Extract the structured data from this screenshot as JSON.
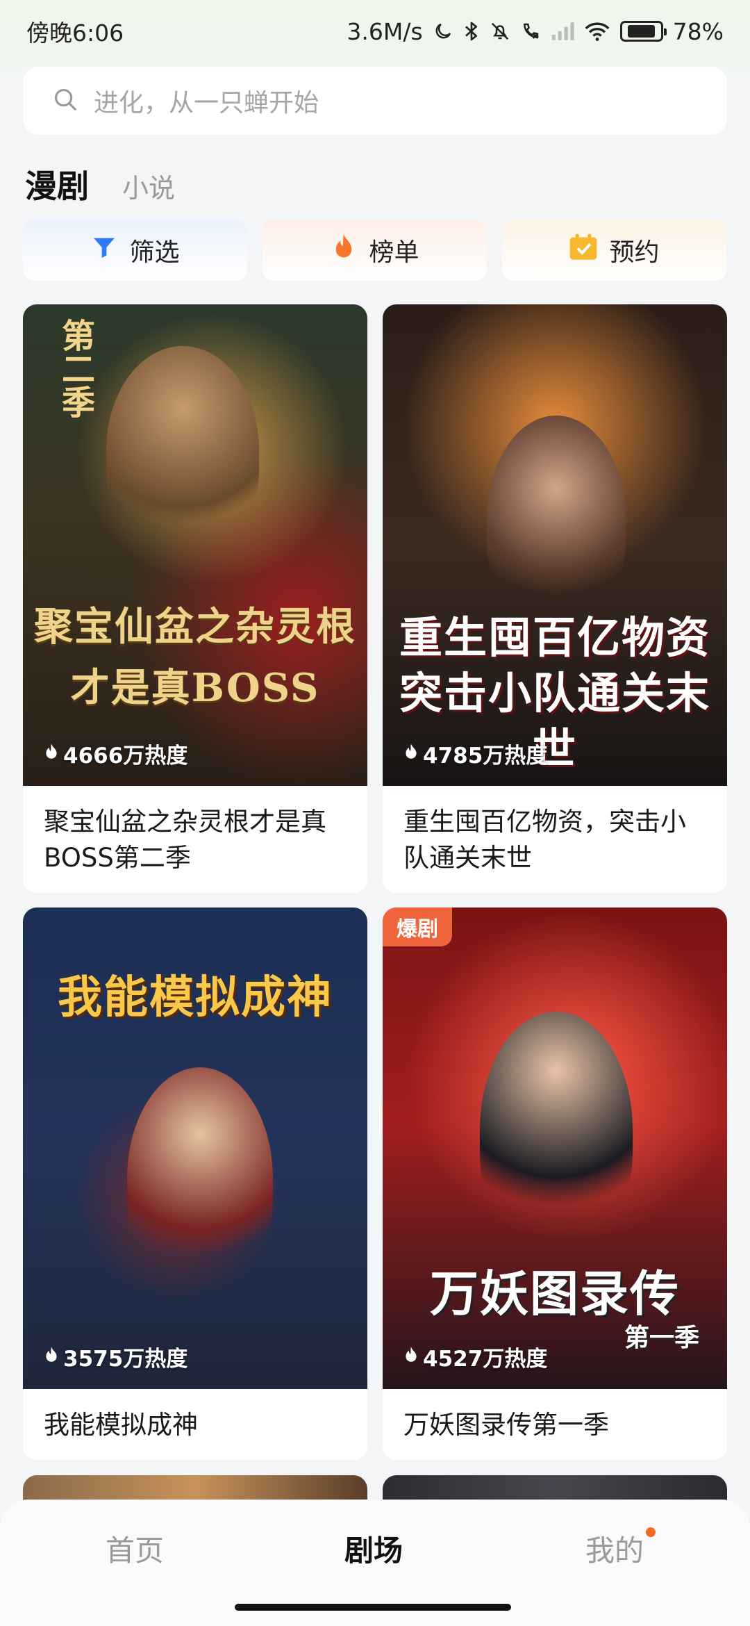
{
  "status_bar": {
    "time": "傍晚6:06",
    "network_speed": "3.6M/s",
    "battery": "78%",
    "battery_level": 0.78
  },
  "search": {
    "placeholder": "进化，从一只蝉开始"
  },
  "tabs": [
    {
      "label": "漫剧",
      "active": true
    },
    {
      "label": "小说",
      "active": false
    }
  ],
  "chips": [
    {
      "label": "筛选",
      "icon": "filter-icon"
    },
    {
      "label": "榜单",
      "icon": "flame-icon"
    },
    {
      "label": "预约",
      "icon": "calendar-check-icon"
    }
  ],
  "cards": [
    {
      "title": "聚宝仙盆之杂灵根才是真BOSS第二季",
      "heat": "4666万热度",
      "poster_title": "聚宝仙盆之杂灵根才是真BOSS",
      "poster_season": "第二季"
    },
    {
      "title": "重生囤百亿物资，突击小队通关末世",
      "heat": "4785万热度",
      "poster_title_line1": "重生囤百亿物资",
      "poster_title_line2": "突击小队通关末世"
    },
    {
      "title": "我能模拟成神",
      "heat": "3575万热度",
      "poster_title": "我能模拟成神"
    },
    {
      "title": "万妖图录传第一季",
      "heat": "4527万热度",
      "badge": "爆剧",
      "poster_title": "万妖图录传",
      "poster_subtitle": "第一季"
    }
  ],
  "bottom_nav": [
    {
      "label": "首页",
      "active": false
    },
    {
      "label": "剧场",
      "active": true
    },
    {
      "label": "我的",
      "active": false,
      "has_dot": true
    }
  ],
  "colors": {
    "accent_orange": "#f26a22",
    "badge_red": "#f0643c",
    "filter_blue": "#2d7cf6"
  }
}
